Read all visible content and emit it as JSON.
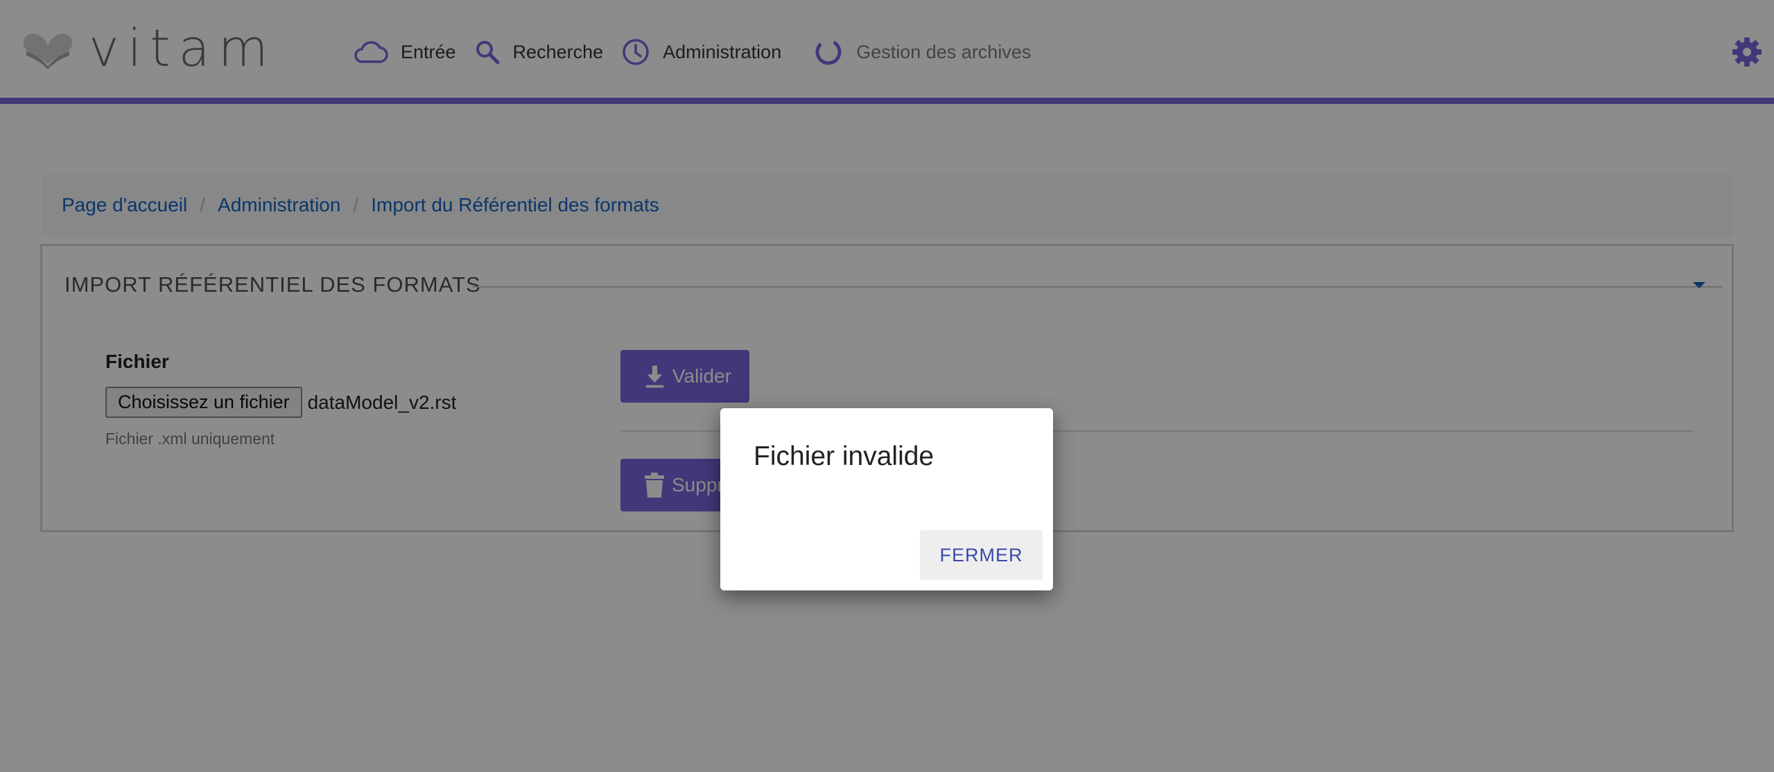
{
  "app": {
    "logo_text": "vitam"
  },
  "nav": {
    "items": [
      {
        "label": "Entrée",
        "icon": "cloud-icon"
      },
      {
        "label": "Recherche",
        "icon": "search-icon"
      },
      {
        "label": "Administration",
        "icon": "clock-icon"
      },
      {
        "label": "Gestion des archives",
        "icon": "loading-ring-icon"
      }
    ]
  },
  "breadcrumb": {
    "items": [
      "Page d'accueil",
      "Administration",
      "Import du Référentiel des formats"
    ],
    "separator": "/"
  },
  "panel": {
    "title": "IMPORT RÉFÉRENTIEL DES FORMATS",
    "file_label": "Fichier",
    "file_button": "Choisissez un fichier",
    "file_name": "dataModel_v2.rst",
    "file_hint": "Fichier .xml uniquement",
    "validate_label": "Valider",
    "delete_label": "Suppr"
  },
  "dialog": {
    "title": "Fichier invalide",
    "close_label": "FERMER"
  },
  "colors": {
    "accent": "#7a64dc",
    "link": "#1565c0",
    "dialog_button_text": "#3949ab"
  }
}
